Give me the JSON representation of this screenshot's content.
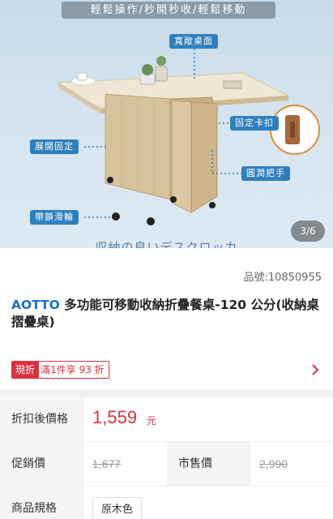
{
  "hero": {
    "banner": "輕鬆操作/秒開秒收/輕鬆移動",
    "callouts": {
      "wide_top": "寬敞桌面",
      "fixed_clip": "固定卡扣",
      "expand_fix": "展開固定",
      "round_handle": "圓潤把手",
      "lock_wheels": "帶鎖滑輪"
    },
    "counter": "3/6",
    "caption": "収納の良いデスクロッカ"
  },
  "product": {
    "sku": "品號:10850955",
    "brand": "AOTTO",
    "title": "多功能可移動收納折疊餐桌-120 公分(收納桌 摺疊桌)"
  },
  "promo": {
    "badge": "現折",
    "text": "滿1件享 93 折"
  },
  "specs": {
    "discount_label": "折扣後價格",
    "discount_price": "1,559",
    "discount_unit": "元",
    "sale_label": "促銷價",
    "sale_price": "1,677",
    "market_label": "市售價",
    "market_price": "2,990",
    "spec_label": "商品規格",
    "spec_value": "原木色"
  },
  "colors": {
    "accent_red": "#d9323f",
    "brand_blue": "#1a6fc4",
    "callout_blue": "#2f7fbf"
  }
}
